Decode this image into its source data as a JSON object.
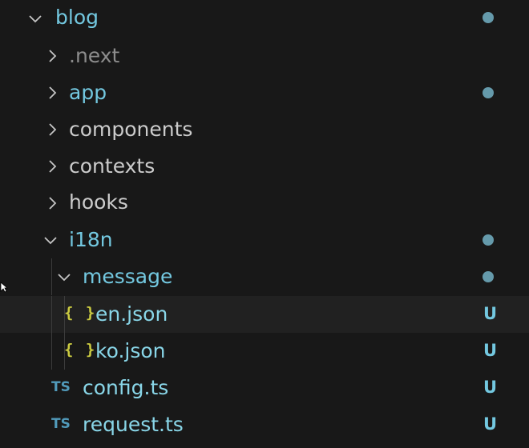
{
  "explorer": {
    "colors": {
      "background": "#181818",
      "selected_row": "#212121",
      "ignored_text": "#8c8c8c",
      "modified_text": "#73c8e0",
      "json_icon": "#cbcb41",
      "ts_icon": "#519aba"
    },
    "rows": [
      {
        "label": "blog",
        "kind": "folder",
        "expanded": true,
        "status": "dot"
      },
      {
        "label": ".next",
        "kind": "folder",
        "expanded": false,
        "status": ""
      },
      {
        "label": "app",
        "kind": "folder",
        "expanded": false,
        "status": "dot"
      },
      {
        "label": "components",
        "kind": "folder",
        "expanded": false,
        "status": ""
      },
      {
        "label": "contexts",
        "kind": "folder",
        "expanded": false,
        "status": ""
      },
      {
        "label": "hooks",
        "kind": "folder",
        "expanded": false,
        "status": ""
      },
      {
        "label": "i18n",
        "kind": "folder",
        "expanded": true,
        "status": "dot"
      },
      {
        "label": "message",
        "kind": "folder",
        "expanded": true,
        "status": "dot"
      },
      {
        "label": "en.json",
        "kind": "file",
        "icon": "{ }",
        "status": "U"
      },
      {
        "label": "ko.json",
        "kind": "file",
        "icon": "{ }",
        "status": "U"
      },
      {
        "label": "config.ts",
        "kind": "file",
        "icon": "TS",
        "status": "U"
      },
      {
        "label": "request.ts",
        "kind": "file",
        "icon": "TS",
        "status": "U"
      }
    ]
  }
}
